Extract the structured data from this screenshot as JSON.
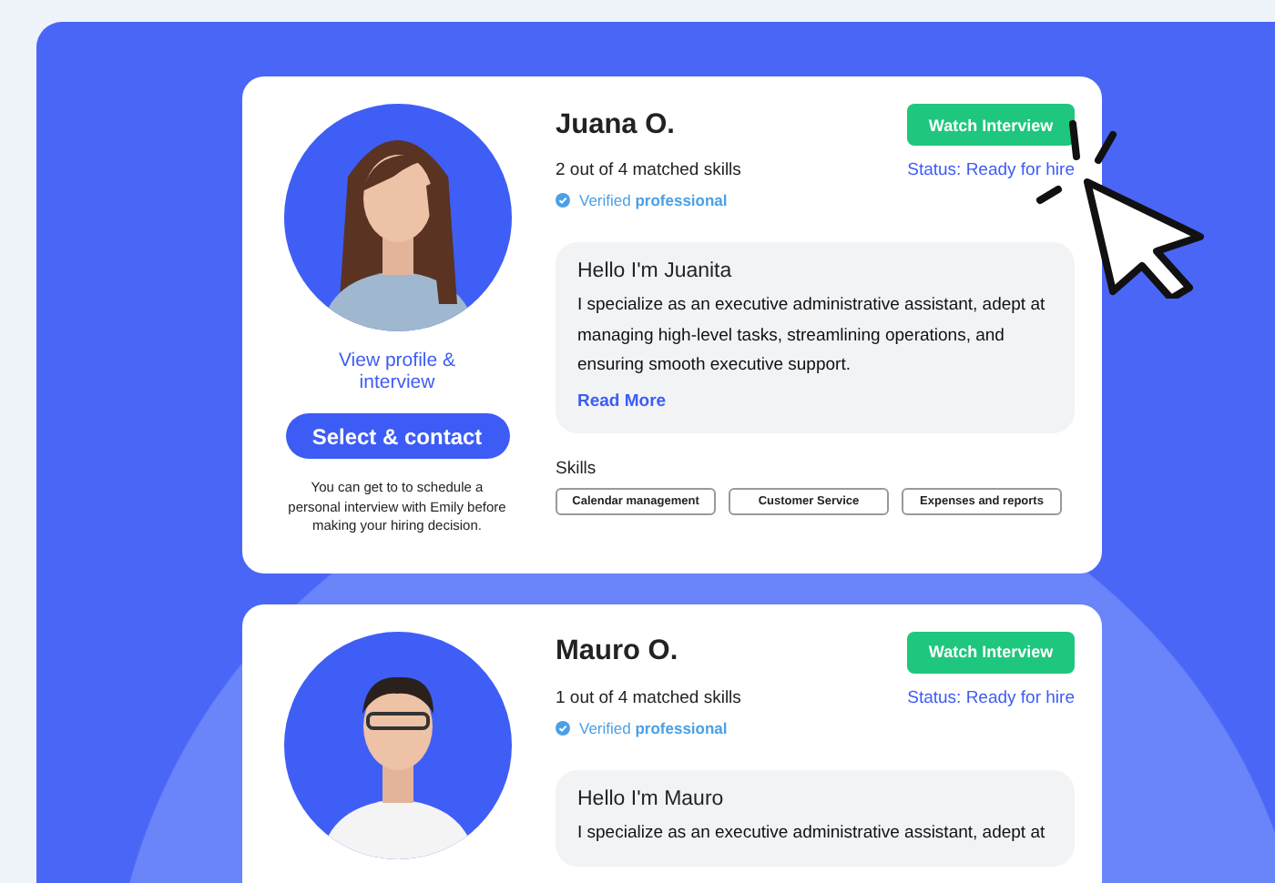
{
  "candidates": [
    {
      "name": "Juana O.",
      "watch_button": "Watch Interview",
      "match": "2 out of 4 matched skills",
      "status": "Status: Ready for hire",
      "verified": "Verified **professional**",
      "profile_link": "View profile & interview",
      "select_button": "Select & contact",
      "note": "You can get to to schedule a personal interview with Emily before making your hiring decision.",
      "bio_title": "Hello I'm Juanita",
      "bio": "I specialize as an executive administrative assistant, adept at managing high-level tasks, streamlining operations, and ensuring smooth executive support.",
      "read_more": "Read More",
      "skills_label": "Skills",
      "skills": [
        "Calendar management",
        "Customer Service",
        "Expenses and reports"
      ]
    },
    {
      "name": "Mauro O.",
      "watch_button": "Watch Interview",
      "match": "1 out of 4 matched skills",
      "status": "Status: Ready for hire",
      "verified": "Verified **professional**",
      "bio_title": "Hello I'm Mauro",
      "bio": "I specialize as an executive administrative assistant, adept at"
    }
  ]
}
